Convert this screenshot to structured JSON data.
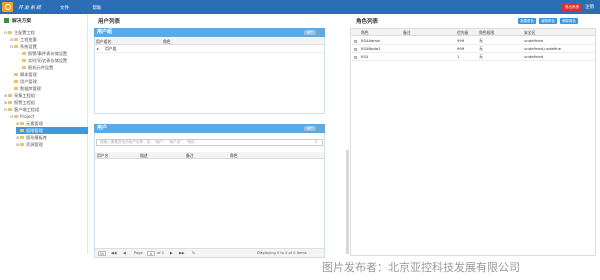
{
  "topbar": {
    "app_title": "开发系统",
    "nav": [
      "文件",
      "帮助"
    ],
    "red_button": "退出系统",
    "right_link": "注销"
  },
  "sidebar": {
    "header": "解决方案",
    "items": [
      {
        "label": "主配置工程",
        "toggle": "⊟"
      },
      {
        "label": "工程变量",
        "toggle": "⊞"
      },
      {
        "label": "系统设置",
        "toggle": "⊟"
      },
      {
        "label": "报警/事件表存储设置",
        "toggle": ""
      },
      {
        "label": "实时/历史表存储设置",
        "toggle": ""
      },
      {
        "label": "报机元件设置",
        "toggle": ""
      },
      {
        "label": "脚本管理",
        "toggle": ""
      },
      {
        "label": "用户管理",
        "toggle": ""
      },
      {
        "label": "数据库管理",
        "toggle": ""
      },
      {
        "label": "采集工程组",
        "toggle": "⊞"
      },
      {
        "label": "报警工程组",
        "toggle": "⊞"
      },
      {
        "label": "客户端工程组",
        "toggle": "⊟"
      },
      {
        "label": "Project",
        "toggle": "⊟"
      },
      {
        "label": "元素管理",
        "toggle": "⊞"
      },
      {
        "label": "权限管理",
        "toggle": ""
      },
      {
        "label": "图形模板库",
        "toggle": "⊞"
      },
      {
        "label": "资源管理",
        "toggle": "⊞"
      }
    ]
  },
  "user_list": {
    "title": "用户列表",
    "group_panel": {
      "title": "用户组",
      "btn": "操作",
      "columns": [
        "用户组名",
        "角色"
      ],
      "rows": [
        {
          "name": "用户组",
          "role": ""
        }
      ]
    },
    "user_panel": {
      "title": "用户",
      "btn": "操作",
      "search_placeholder": "请输入需要查找的用户名称，如：\"用户\"、\"用户名\"、\"角色\"...",
      "columns": [
        "用户名",
        "描述",
        "备注",
        "角色"
      ],
      "pager": {
        "page_size": "30",
        "page_label": "Page",
        "page_value": "0",
        "of_label": "of 0",
        "display": "Displaying 0 to 0 of 0 items"
      }
    }
  },
  "role_list": {
    "title": "角色列表",
    "buttons": [
      "新建角色",
      "编辑角色",
      "删除角色"
    ],
    "columns": [
      "角色",
      "备注",
      "优先级",
      "角色权限",
      "安全区"
    ],
    "rows": [
      {
        "role": "KS4Admin",
        "note": "",
        "priority": "999",
        "perm": "无",
        "zone": "undefined"
      },
      {
        "role": "KS4Node1",
        "note": "",
        "priority": "999",
        "perm": "无",
        "zone": "undefined,undefine"
      },
      {
        "role": "KS4",
        "note": "",
        "priority": "1",
        "perm": "无",
        "zone": "undefined"
      }
    ]
  },
  "watermark": "图片发布者：北京亚控科技发展有限公司"
}
